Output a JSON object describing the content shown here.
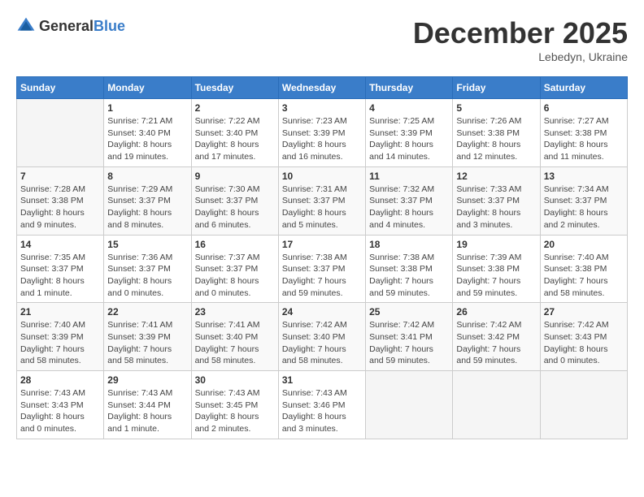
{
  "logo": {
    "general": "General",
    "blue": "Blue"
  },
  "title": "December 2025",
  "subtitle": "Lebedyn, Ukraine",
  "days_of_week": [
    "Sunday",
    "Monday",
    "Tuesday",
    "Wednesday",
    "Thursday",
    "Friday",
    "Saturday"
  ],
  "weeks": [
    [
      {
        "day": "",
        "info": ""
      },
      {
        "day": "1",
        "info": "Sunrise: 7:21 AM\nSunset: 3:40 PM\nDaylight: 8 hours\nand 19 minutes."
      },
      {
        "day": "2",
        "info": "Sunrise: 7:22 AM\nSunset: 3:40 PM\nDaylight: 8 hours\nand 17 minutes."
      },
      {
        "day": "3",
        "info": "Sunrise: 7:23 AM\nSunset: 3:39 PM\nDaylight: 8 hours\nand 16 minutes."
      },
      {
        "day": "4",
        "info": "Sunrise: 7:25 AM\nSunset: 3:39 PM\nDaylight: 8 hours\nand 14 minutes."
      },
      {
        "day": "5",
        "info": "Sunrise: 7:26 AM\nSunset: 3:38 PM\nDaylight: 8 hours\nand 12 minutes."
      },
      {
        "day": "6",
        "info": "Sunrise: 7:27 AM\nSunset: 3:38 PM\nDaylight: 8 hours\nand 11 minutes."
      }
    ],
    [
      {
        "day": "7",
        "info": "Sunrise: 7:28 AM\nSunset: 3:38 PM\nDaylight: 8 hours\nand 9 minutes."
      },
      {
        "day": "8",
        "info": "Sunrise: 7:29 AM\nSunset: 3:37 PM\nDaylight: 8 hours\nand 8 minutes."
      },
      {
        "day": "9",
        "info": "Sunrise: 7:30 AM\nSunset: 3:37 PM\nDaylight: 8 hours\nand 6 minutes."
      },
      {
        "day": "10",
        "info": "Sunrise: 7:31 AM\nSunset: 3:37 PM\nDaylight: 8 hours\nand 5 minutes."
      },
      {
        "day": "11",
        "info": "Sunrise: 7:32 AM\nSunset: 3:37 PM\nDaylight: 8 hours\nand 4 minutes."
      },
      {
        "day": "12",
        "info": "Sunrise: 7:33 AM\nSunset: 3:37 PM\nDaylight: 8 hours\nand 3 minutes."
      },
      {
        "day": "13",
        "info": "Sunrise: 7:34 AM\nSunset: 3:37 PM\nDaylight: 8 hours\nand 2 minutes."
      }
    ],
    [
      {
        "day": "14",
        "info": "Sunrise: 7:35 AM\nSunset: 3:37 PM\nDaylight: 8 hours\nand 1 minute."
      },
      {
        "day": "15",
        "info": "Sunrise: 7:36 AM\nSunset: 3:37 PM\nDaylight: 8 hours\nand 0 minutes."
      },
      {
        "day": "16",
        "info": "Sunrise: 7:37 AM\nSunset: 3:37 PM\nDaylight: 8 hours\nand 0 minutes."
      },
      {
        "day": "17",
        "info": "Sunrise: 7:38 AM\nSunset: 3:37 PM\nDaylight: 7 hours\nand 59 minutes."
      },
      {
        "day": "18",
        "info": "Sunrise: 7:38 AM\nSunset: 3:38 PM\nDaylight: 7 hours\nand 59 minutes."
      },
      {
        "day": "19",
        "info": "Sunrise: 7:39 AM\nSunset: 3:38 PM\nDaylight: 7 hours\nand 59 minutes."
      },
      {
        "day": "20",
        "info": "Sunrise: 7:40 AM\nSunset: 3:38 PM\nDaylight: 7 hours\nand 58 minutes."
      }
    ],
    [
      {
        "day": "21",
        "info": "Sunrise: 7:40 AM\nSunset: 3:39 PM\nDaylight: 7 hours\nand 58 minutes."
      },
      {
        "day": "22",
        "info": "Sunrise: 7:41 AM\nSunset: 3:39 PM\nDaylight: 7 hours\nand 58 minutes."
      },
      {
        "day": "23",
        "info": "Sunrise: 7:41 AM\nSunset: 3:40 PM\nDaylight: 7 hours\nand 58 minutes."
      },
      {
        "day": "24",
        "info": "Sunrise: 7:42 AM\nSunset: 3:40 PM\nDaylight: 7 hours\nand 58 minutes."
      },
      {
        "day": "25",
        "info": "Sunrise: 7:42 AM\nSunset: 3:41 PM\nDaylight: 7 hours\nand 59 minutes."
      },
      {
        "day": "26",
        "info": "Sunrise: 7:42 AM\nSunset: 3:42 PM\nDaylight: 7 hours\nand 59 minutes."
      },
      {
        "day": "27",
        "info": "Sunrise: 7:42 AM\nSunset: 3:43 PM\nDaylight: 8 hours\nand 0 minutes."
      }
    ],
    [
      {
        "day": "28",
        "info": "Sunrise: 7:43 AM\nSunset: 3:43 PM\nDaylight: 8 hours\nand 0 minutes."
      },
      {
        "day": "29",
        "info": "Sunrise: 7:43 AM\nSunset: 3:44 PM\nDaylight: 8 hours\nand 1 minute."
      },
      {
        "day": "30",
        "info": "Sunrise: 7:43 AM\nSunset: 3:45 PM\nDaylight: 8 hours\nand 2 minutes."
      },
      {
        "day": "31",
        "info": "Sunrise: 7:43 AM\nSunset: 3:46 PM\nDaylight: 8 hours\nand 3 minutes."
      },
      {
        "day": "",
        "info": ""
      },
      {
        "day": "",
        "info": ""
      },
      {
        "day": "",
        "info": ""
      }
    ]
  ]
}
